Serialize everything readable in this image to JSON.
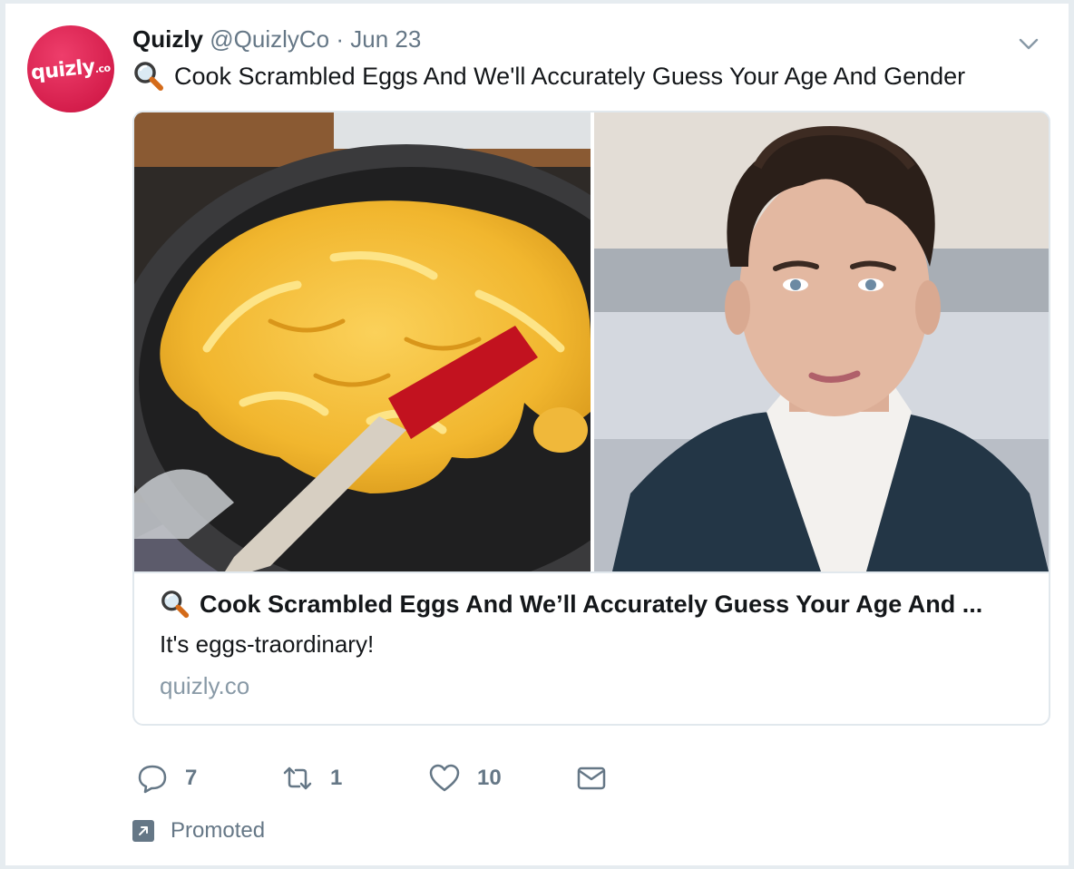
{
  "tweet": {
    "avatar_label": "quizly",
    "avatar_suffix": ".co",
    "author_name": "Quizly",
    "author_handle": "@QuizlyCo",
    "separator": "·",
    "date": "Jun 23",
    "text": "Cook Scrambled Eggs And We'll Accurately Guess Your Age And Gender",
    "text_icon": "magnifying-glass-emoji-icon"
  },
  "card": {
    "left_image": "scrambled-eggs-in-pan-photo",
    "right_image": "man-in-dark-suit-portrait-photo",
    "title": "Cook Scrambled Eggs And We’ll Accurately Guess Your Age And ...",
    "description": "It's eggs-traordinary!",
    "domain": "quizly.co"
  },
  "actions": {
    "reply_count": "7",
    "retweet_count": "1",
    "like_count": "10"
  },
  "promoted_label": "Promoted",
  "colors": {
    "brand": "#d51e4c",
    "secondary_text": "#657786",
    "border": "#e1e8ed"
  }
}
